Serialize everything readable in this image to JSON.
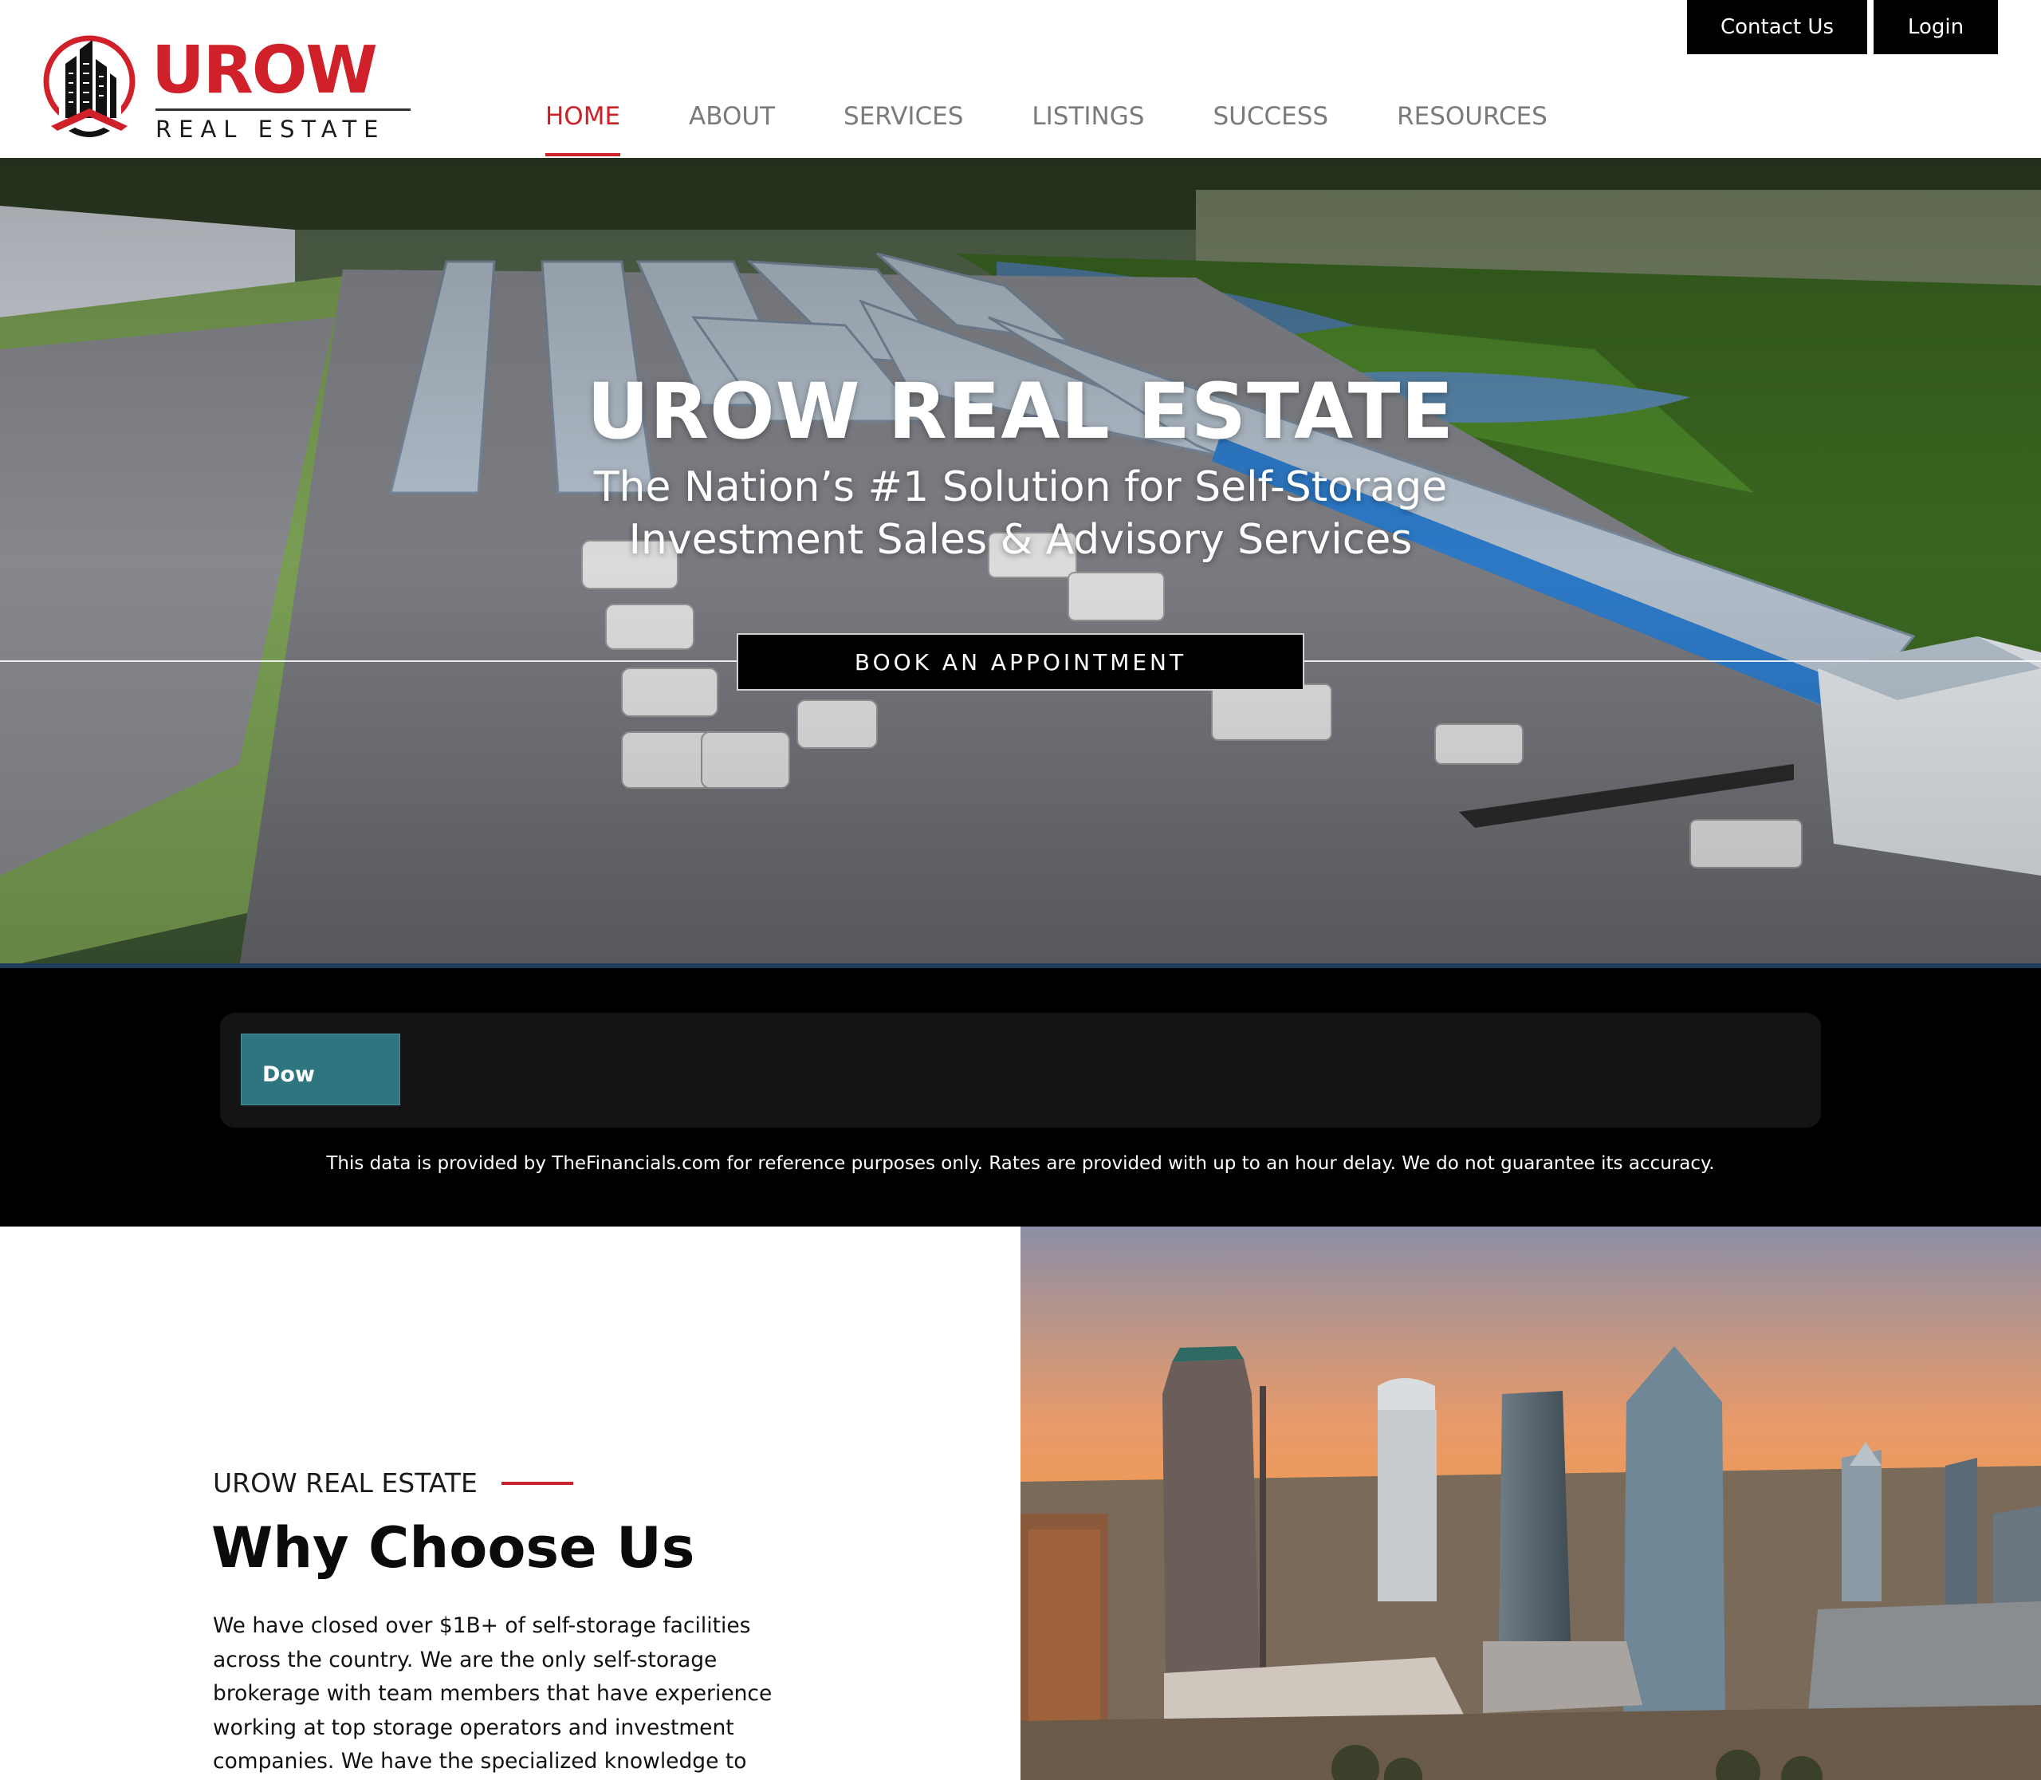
{
  "brand": {
    "name": "UROW",
    "tagline": "REAL ESTATE",
    "red": "#d0202a",
    "dark": "#1b1b1b"
  },
  "top_buttons": {
    "contact": "Contact Us",
    "login": "Login"
  },
  "nav": {
    "items": [
      {
        "label": "HOME",
        "active": true
      },
      {
        "label": "ABOUT",
        "active": false
      },
      {
        "label": "SERVICES",
        "active": false
      },
      {
        "label": "LISTINGS",
        "active": false
      },
      {
        "label": "SUCCESS",
        "active": false
      },
      {
        "label": "RESOURCES",
        "active": false
      }
    ],
    "active_color": "#cc2128",
    "inactive_color": "#7a7a7a"
  },
  "hero": {
    "title": "UROW REAL ESTATE",
    "subtitle_line1": "The Nation’s #1 Solution for Self-Storage",
    "subtitle_line2": "Investment Sales & Advisory Services",
    "cta": "BOOK AN APPOINTMENT",
    "image": "aerial-self-storage-facility-photo"
  },
  "ticker": {
    "tab_label": "Dow",
    "tab_color": "#2e7580",
    "disclaimer": "This data is provided by TheFinancials.com for reference purposes only. Rates are provided with up to an hour delay. We do not guarantee its accuracy."
  },
  "why": {
    "eyebrow": "UROW REAL ESTATE",
    "title": "Why Choose Us",
    "body_lines": [
      "We have closed over $1B+ of self-storage facilities",
      "across the country. We are the only self-storage",
      "brokerage with team members that have experience",
      "working at top storage operators and investment",
      "companies. We have the specialized knowledge to"
    ],
    "image": "city-skyline-sunset-photo"
  }
}
